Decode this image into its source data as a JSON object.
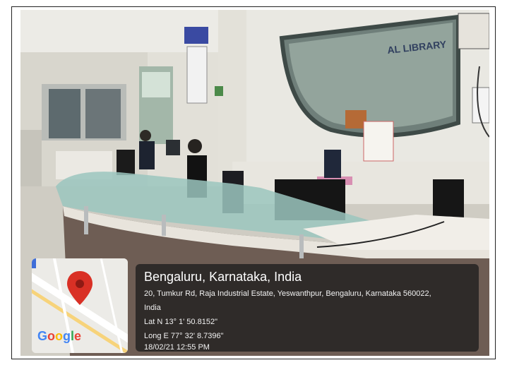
{
  "location": {
    "title": "Bengaluru, Karnataka, India",
    "address_line1": "20, Tumkur Rd, Raja Industrial Estate, Yeswanthpur, Bengaluru, Karnataka 560022,",
    "address_line2": "India",
    "latitude": "Lat N 13° 1' 50.8152\"",
    "longitude": "Long E 77° 32' 8.7396\"",
    "datetime": "18/02/21 12:55 PM"
  },
  "map": {
    "logo_letters": [
      "G",
      "o",
      "o",
      "g",
      "l",
      "e"
    ],
    "logo_colors": [
      "#4285F4",
      "#EA4335",
      "#FBBC05",
      "#4285F4",
      "#34A853",
      "#EA4335"
    ],
    "pin_color": "#D93025"
  },
  "scene": {
    "sign_text": "AL LIBRARY"
  }
}
